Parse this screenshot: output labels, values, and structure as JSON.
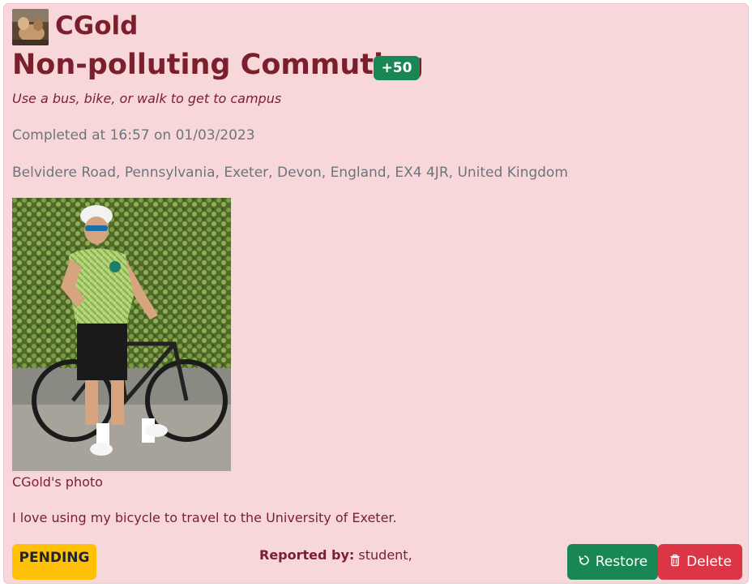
{
  "post": {
    "username": "CGold",
    "title": "Non-polluting Commuting",
    "points": "+50",
    "description": "Use a bus, bike, or walk to get to campus",
    "completed": "Completed at 16:57 on 01/03/2023",
    "location": "Belvidere Road, Pennsylvania, Exeter, Devon, England, EX4 4JR, United Kingdom",
    "photo_caption": "CGold's photo",
    "comment": "I love using my bicycle to travel to the University of Exeter.",
    "status": "PENDING",
    "reported_label": "Reported by:",
    "reported_value": "student,"
  },
  "actions": {
    "restore_label": "Restore",
    "delete_label": "Delete",
    "restore_icon": "restore-icon",
    "delete_icon": "trash-icon"
  },
  "colors": {
    "card_bg": "#f8d7da",
    "text": "#7a1f2b",
    "success": "#198754",
    "danger": "#dc3545",
    "warning": "#ffc107",
    "muted": "#6c757d"
  }
}
